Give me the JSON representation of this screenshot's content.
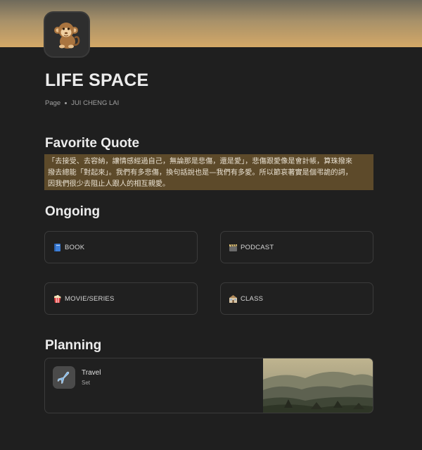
{
  "page": {
    "icon": "monkey-icon",
    "title": "LIFE SPACE",
    "meta_type": "Page",
    "meta_author": "JUI CHENG LAI"
  },
  "quote_section": {
    "heading": "Favorite Quote",
    "lines": [
      "「去接受、去容納，讓情感經過自己，無論那是悲傷，還是愛」，悲傷跟愛像是會計帳，算珠撥來",
      "撥去總能「對起來」。我們有多悲傷，換句話說也是—我們有多愛。所以節哀著實是個弔詭的詞，",
      "因我們很少去阻止人跟人的相互親愛。"
    ]
  },
  "ongoing": {
    "heading": "Ongoing",
    "items": [
      {
        "icon": "book-icon",
        "label": "BOOK"
      },
      {
        "icon": "clapper-icon",
        "label": "PODCAST"
      },
      {
        "icon": "popcorn-icon",
        "label": "MOVIE/SERIES"
      },
      {
        "icon": "school-icon",
        "label": "CLASS"
      }
    ]
  },
  "planning": {
    "heading": "Planning",
    "card": {
      "icon": "airplane-icon",
      "name": "Travel",
      "subtitle": "Set",
      "image": "mountain-landscape-image"
    }
  },
  "colors": {
    "background": "#1f1f1f",
    "quote_highlight": "#5d4a2a",
    "card_border": "#3b3b3b"
  }
}
